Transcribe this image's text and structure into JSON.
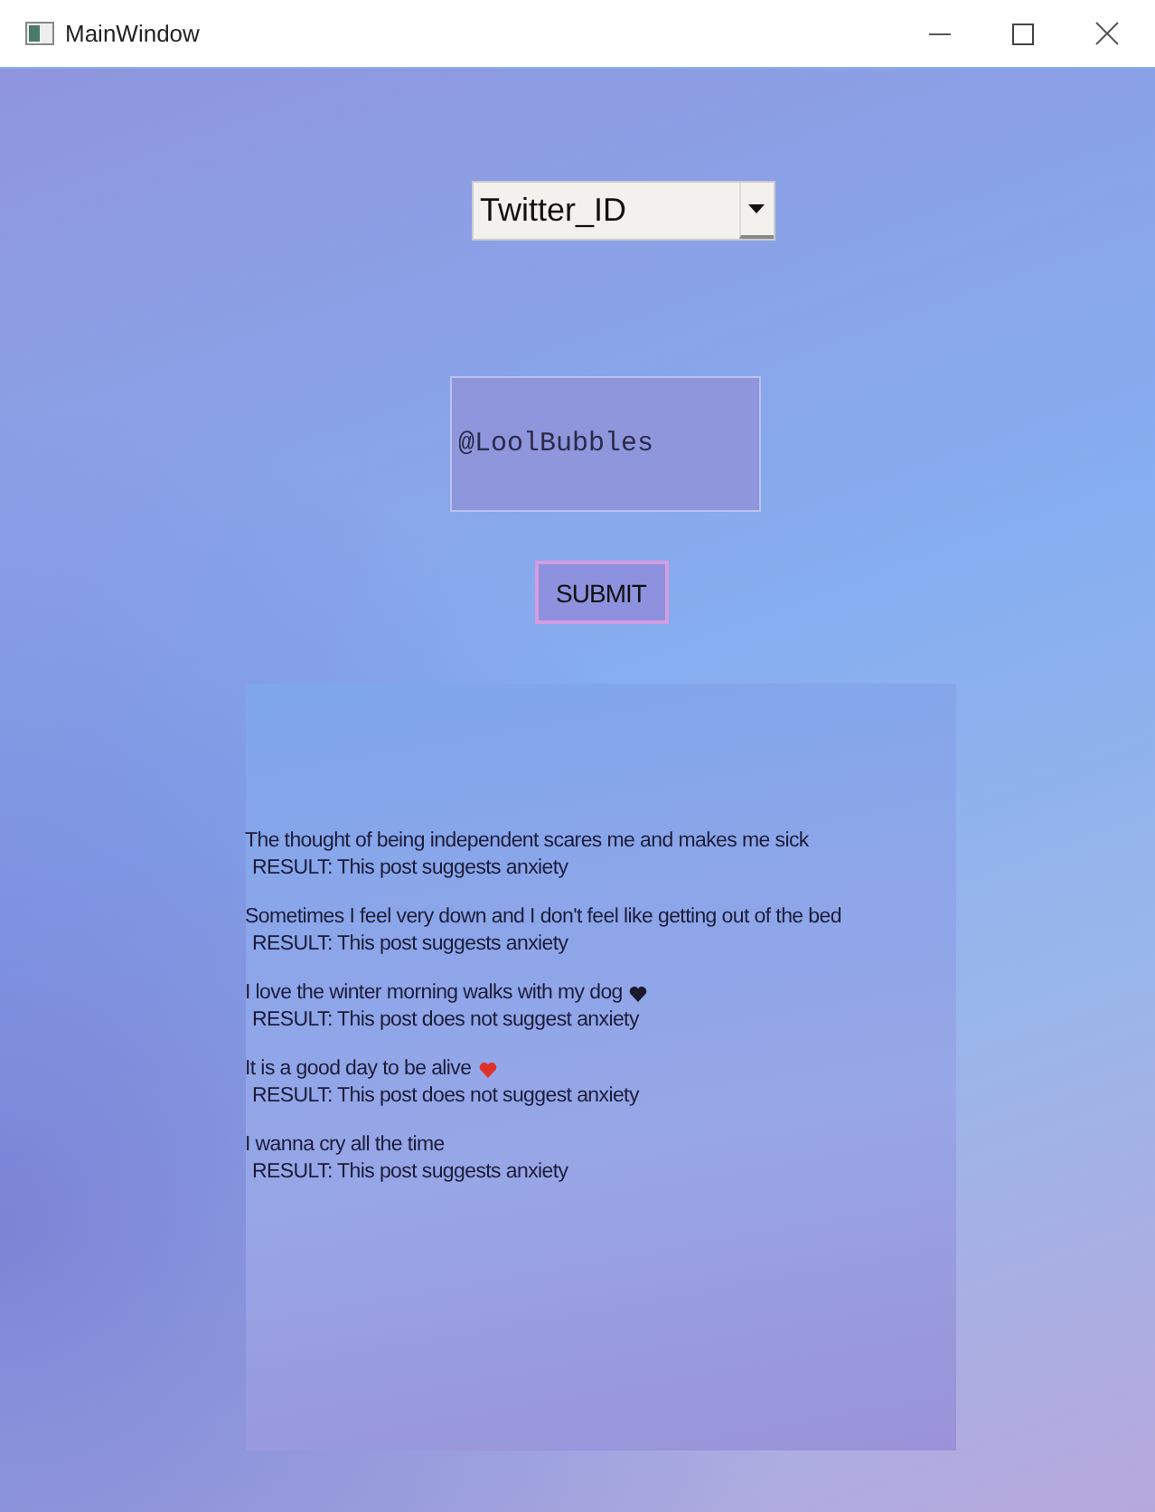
{
  "window": {
    "title": "MainWindow"
  },
  "source_select": {
    "value": "Twitter_ID"
  },
  "handle_field": {
    "value": "@LoolBubbles"
  },
  "submit_button": {
    "label": "SUBMIT"
  },
  "results": [
    {
      "post": "The thought of being independent scares me and makes me sick",
      "result": "RESULT: This post suggests anxiety"
    },
    {
      "post": "Sometimes I feel very down and I don't feel like getting out of the bed",
      "result": "RESULT: This post suggests anxiety"
    },
    {
      "post": "I love the winter morning walks with my dog",
      "result": "RESULT: This post does not suggest anxiety",
      "color": "#1a1a2a"
    },
    {
      "post": "It is a good day to be alive",
      "result": "RESULT: This post does not suggest anxiety",
      "color": "#e0302a"
    },
    {
      "post": "I wanna cry all the time",
      "result": "RESULT: This post suggests anxiety"
    }
  ]
}
